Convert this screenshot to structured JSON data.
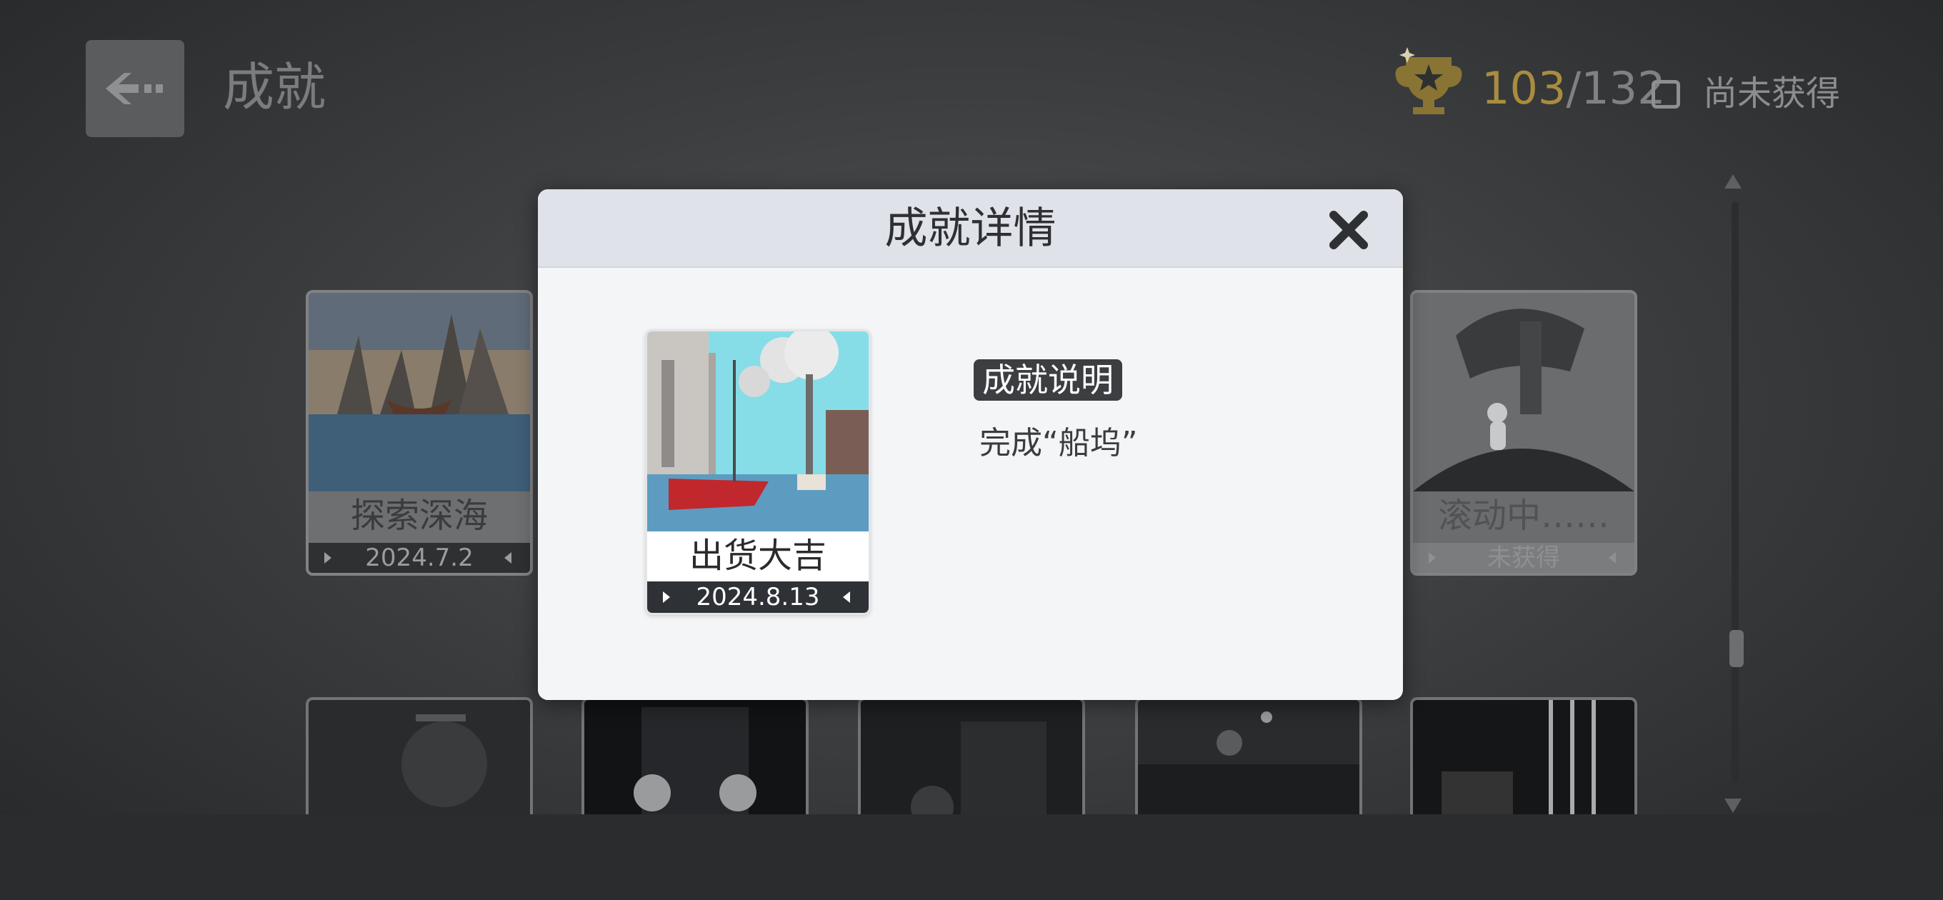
{
  "header": {
    "title": "成就",
    "progress_got": "103",
    "progress_total": "/132",
    "filter_label": "尚未获得"
  },
  "modal": {
    "title": "成就详情",
    "achievement": {
      "name": "出货大吉",
      "date": "2024.8.13"
    },
    "description_label": "成就说明",
    "description": "完成“船坞”"
  },
  "cards": [
    {
      "name": "探索深海",
      "date": "2024.7.2"
    },
    {
      "name": "滚动中……",
      "date": "未获得"
    }
  ],
  "colors": {
    "accent_gold": "#a98c3f",
    "modal_bg": "#f4f5f6",
    "modal_header": "#dfe2e8"
  }
}
